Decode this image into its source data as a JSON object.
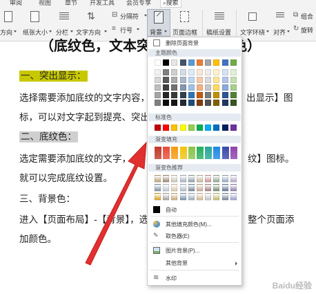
{
  "menubar": [
    "审阅",
    "视图",
    "章节",
    "开发工具",
    "会员专享",
    "搜索"
  ],
  "toolbar": {
    "direction": "方向",
    "papersize": "纸张大小",
    "columns": "分栏",
    "textdirection": "文字方向",
    "breaks": "分隔符",
    "linenum": "行号",
    "background": "背景",
    "pageborder": "页面边框",
    "draftsettings": "稿纸设置",
    "textwrap": "文字环绕",
    "align": "对齐",
    "combine": "组合",
    "rotate": "旋转"
  },
  "doc": {
    "title": "（底纹色，文本突出显示，背景色）",
    "h1": "一、突出显示：",
    "p1a": "选择需要添加底纹的文字内容，点",
    "p1b": "出显示】图",
    "p2a": "标，可以对文字起到提亮、突出显",
    "h2": "二、底纹色：",
    "p3a": "选定需要添加底纹的文字，点",
    "p3b": "纹】图标。",
    "p4": "就可以完成底纹设置。",
    "h3": "三、背景色：",
    "p5a": "进入【页面布局】-【背景】，选择",
    "p5b": "整个页面添",
    "p6": "加颜色。"
  },
  "dropdown": {
    "remove_bg": "删除页面背景",
    "theme_colors": "主题颜色",
    "standard_colors": "标准色",
    "gradient_fill": "渐变填充",
    "gradient_recommend": "渐变色推荐",
    "auto": "自动",
    "more_colors": "其他填充颜色(M)...",
    "eyedropper": "取色器(E)",
    "picture_bg": "图片背景(P)...",
    "other_bg": "其他背景",
    "watermark": "水印"
  },
  "colors": {
    "theme_top": [
      "#ffffff",
      "#000000",
      "#e7e6e6",
      "#44546a",
      "#5b9bd5",
      "#ed7d31",
      "#a5a5a5",
      "#ffc000",
      "#4472c4",
      "#70ad47"
    ],
    "theme_shades": [
      [
        "#f2f2f2",
        "#7f7f7f",
        "#d0cece",
        "#d6dce4",
        "#deebf6",
        "#fbe5d5",
        "#ededed",
        "#fff2cc",
        "#d9e2f3",
        "#e2efd9"
      ],
      [
        "#d8d8d8",
        "#595959",
        "#aeabab",
        "#adb9ca",
        "#bdd7ee",
        "#f7cbac",
        "#dbdbdb",
        "#fee599",
        "#b4c6e7",
        "#c5e0b3"
      ],
      [
        "#bfbfbf",
        "#3f3f3f",
        "#757070",
        "#8496b0",
        "#9dc3e6",
        "#f4b183",
        "#c9c9c9",
        "#ffd965",
        "#8eaadb",
        "#a8d08d"
      ],
      [
        "#a5a5a5",
        "#262626",
        "#3a3838",
        "#323f4f",
        "#2e75b5",
        "#c55a11",
        "#7b7b7b",
        "#bf9000",
        "#2f5496",
        "#538135"
      ],
      [
        "#7f7f7f",
        "#0c0c0c",
        "#171616",
        "#222a35",
        "#1e4e79",
        "#833c0b",
        "#525252",
        "#7f6000",
        "#1f3864",
        "#375623"
      ]
    ],
    "standard": [
      "#c00000",
      "#ff0000",
      "#ffc000",
      "#ffff00",
      "#92d050",
      "#00b050",
      "#00b0f0",
      "#0070c0",
      "#002060",
      "#7030a0"
    ],
    "gradient": [
      "#c0392b",
      "#e74c3c",
      "#f39c12",
      "#f1c40f",
      "#8bc34a",
      "#27ae60",
      "#26a69a",
      "#1e88e5",
      "#3949ab",
      "#8e44ad"
    ],
    "recommend_row1": [
      "#b8a070",
      "#9a8468",
      "#c9c2b3",
      "#a4b0bd",
      "#8c9aa8",
      "#c6b49a",
      "#c98f8f",
      "#8fa38a",
      "#93a6bf",
      "#b2a3c9"
    ],
    "recommend_row2": [
      "#7a8ca0",
      "#b9c5cf",
      "#d8c6a8",
      "#aeb8c4",
      "#6e7f92",
      "#c4a48a",
      "#a37a7a",
      "#6b8a6b",
      "#586d8c",
      "#8c7aa6"
    ],
    "recommend_row3": [
      "#d4a017",
      "#a0a0a0",
      "#c8a878",
      "#6e8da8",
      "#99aabb",
      "#d2b48c",
      "#c0c0c0",
      "#bdb76b",
      "#708090",
      "#9999cc"
    ],
    "highlight_yellow": "#c8c800",
    "shading_gray": "#cfcfcf",
    "arrow": "#e03030"
  },
  "watermark": "Baidu经验"
}
